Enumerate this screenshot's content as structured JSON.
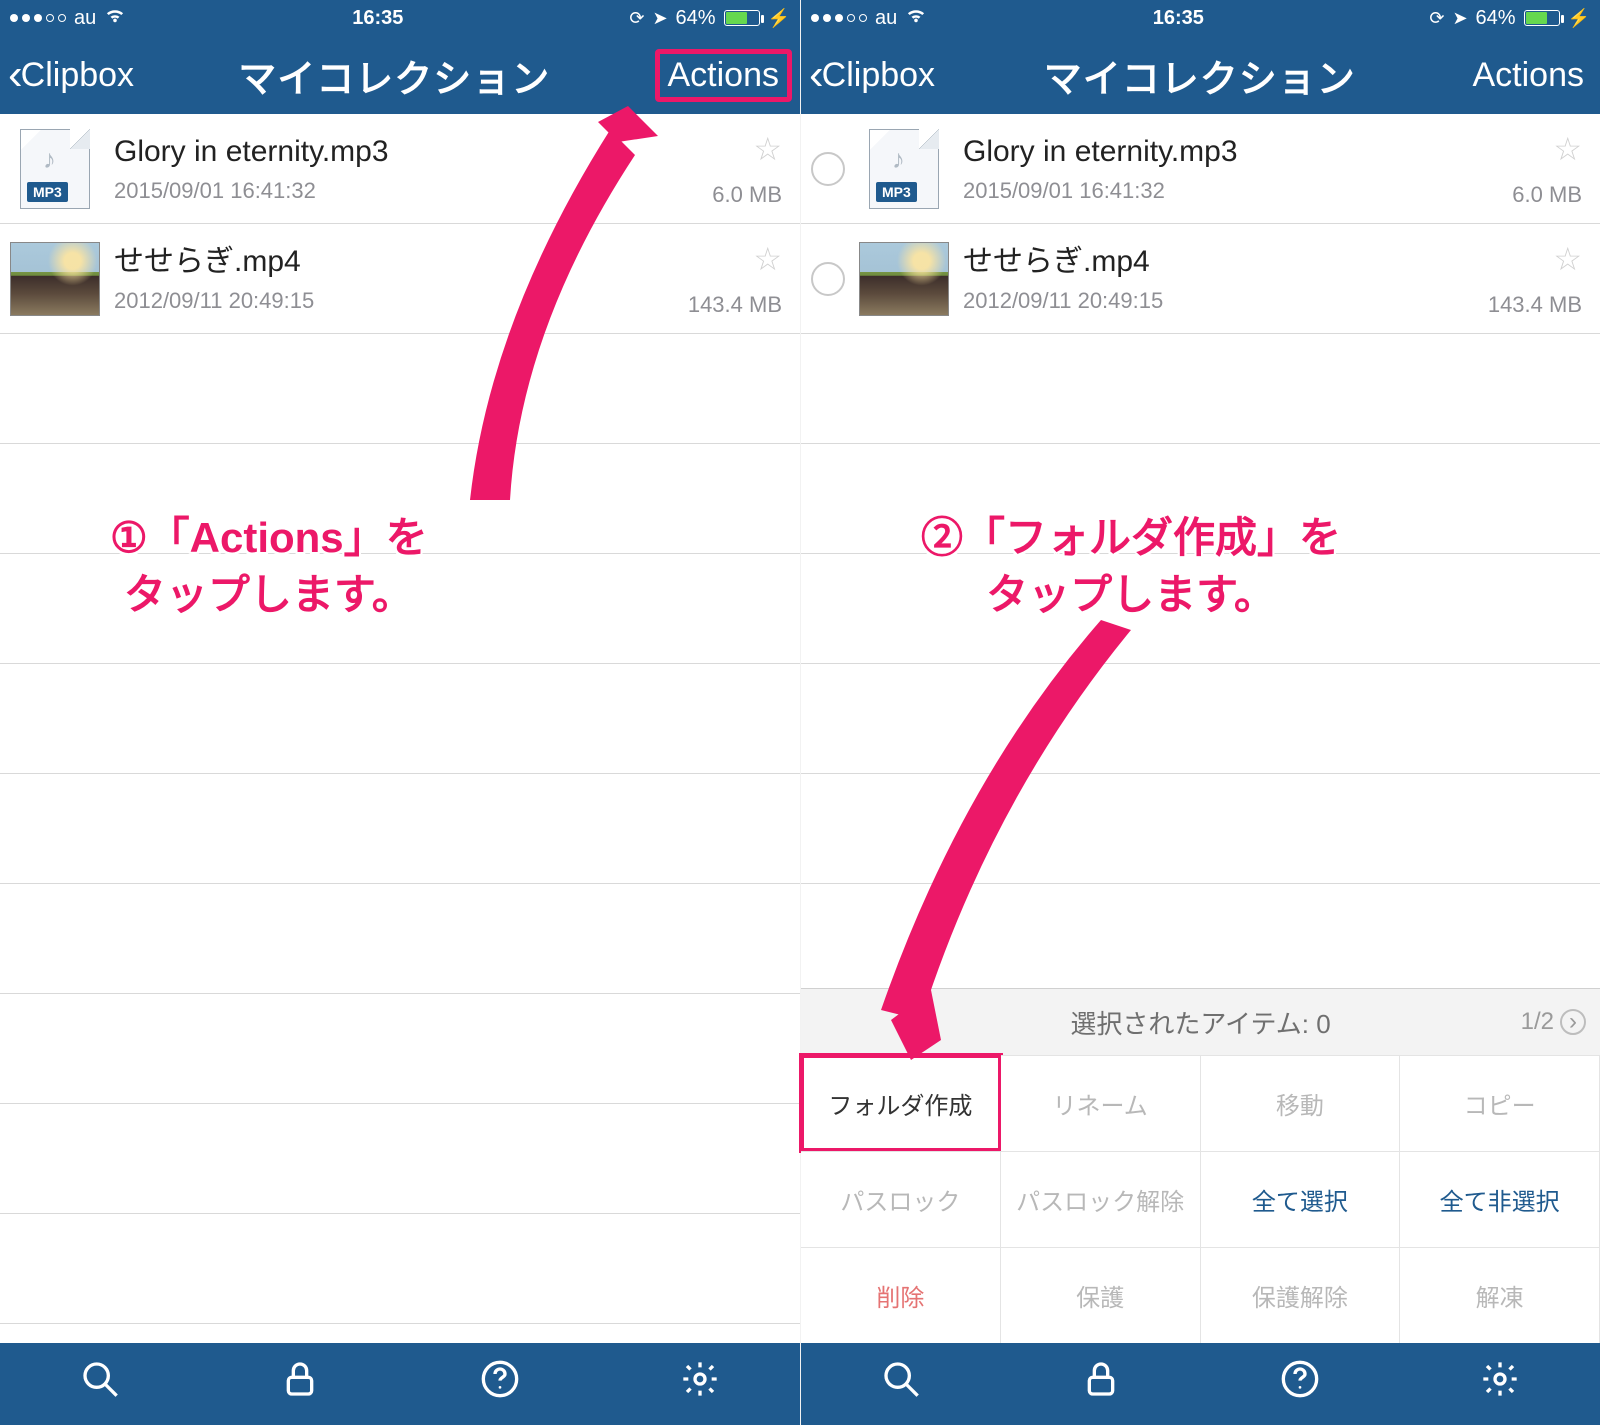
{
  "status": {
    "carrier": "au",
    "time": "16:35",
    "battery_pct": "64%"
  },
  "nav": {
    "back_label": "Clipbox",
    "title": "マイコレクション",
    "action_label": "Actions"
  },
  "files": [
    {
      "name": "Glory in eternity.mp3",
      "date": "2015/09/01 16:41:32",
      "size": "6.0 MB",
      "type": "mp3",
      "badge": "MP3"
    },
    {
      "name": "せせらぎ.mp4",
      "date": "2012/09/11 20:49:15",
      "size": "143.4 MB",
      "type": "img"
    }
  ],
  "files_right": [
    {
      "name": "Glory in eternity.mp3",
      "date": "2015/09/01 16:41:32",
      "size": "6.0 MB",
      "type": "mp3",
      "badge": "MP3"
    },
    {
      "name": "せせらぎ.mp4",
      "date": "2012/09/11 20:49:15",
      "size": "143.4 MB",
      "type": "img"
    }
  ],
  "actions_panel": {
    "header": "選択されたアイテム: 0",
    "pager": "1/2",
    "buttons": [
      {
        "label": "フォルダ作成",
        "style": "enabled boxed"
      },
      {
        "label": "リネーム",
        "style": ""
      },
      {
        "label": "移動",
        "style": ""
      },
      {
        "label": "コピー",
        "style": ""
      },
      {
        "label": "パスロック",
        "style": ""
      },
      {
        "label": "パスロック解除",
        "style": ""
      },
      {
        "label": "全て選択",
        "style": "blue"
      },
      {
        "label": "全て非選択",
        "style": "blue"
      },
      {
        "label": "削除",
        "style": "red"
      },
      {
        "label": "保護",
        "style": ""
      },
      {
        "label": "保護解除",
        "style": ""
      },
      {
        "label": "解凍",
        "style": ""
      }
    ]
  },
  "annotations": {
    "left": "①「Actions」を\nタップします。",
    "right": "②「フォルダ作成」を\nタップします。"
  }
}
